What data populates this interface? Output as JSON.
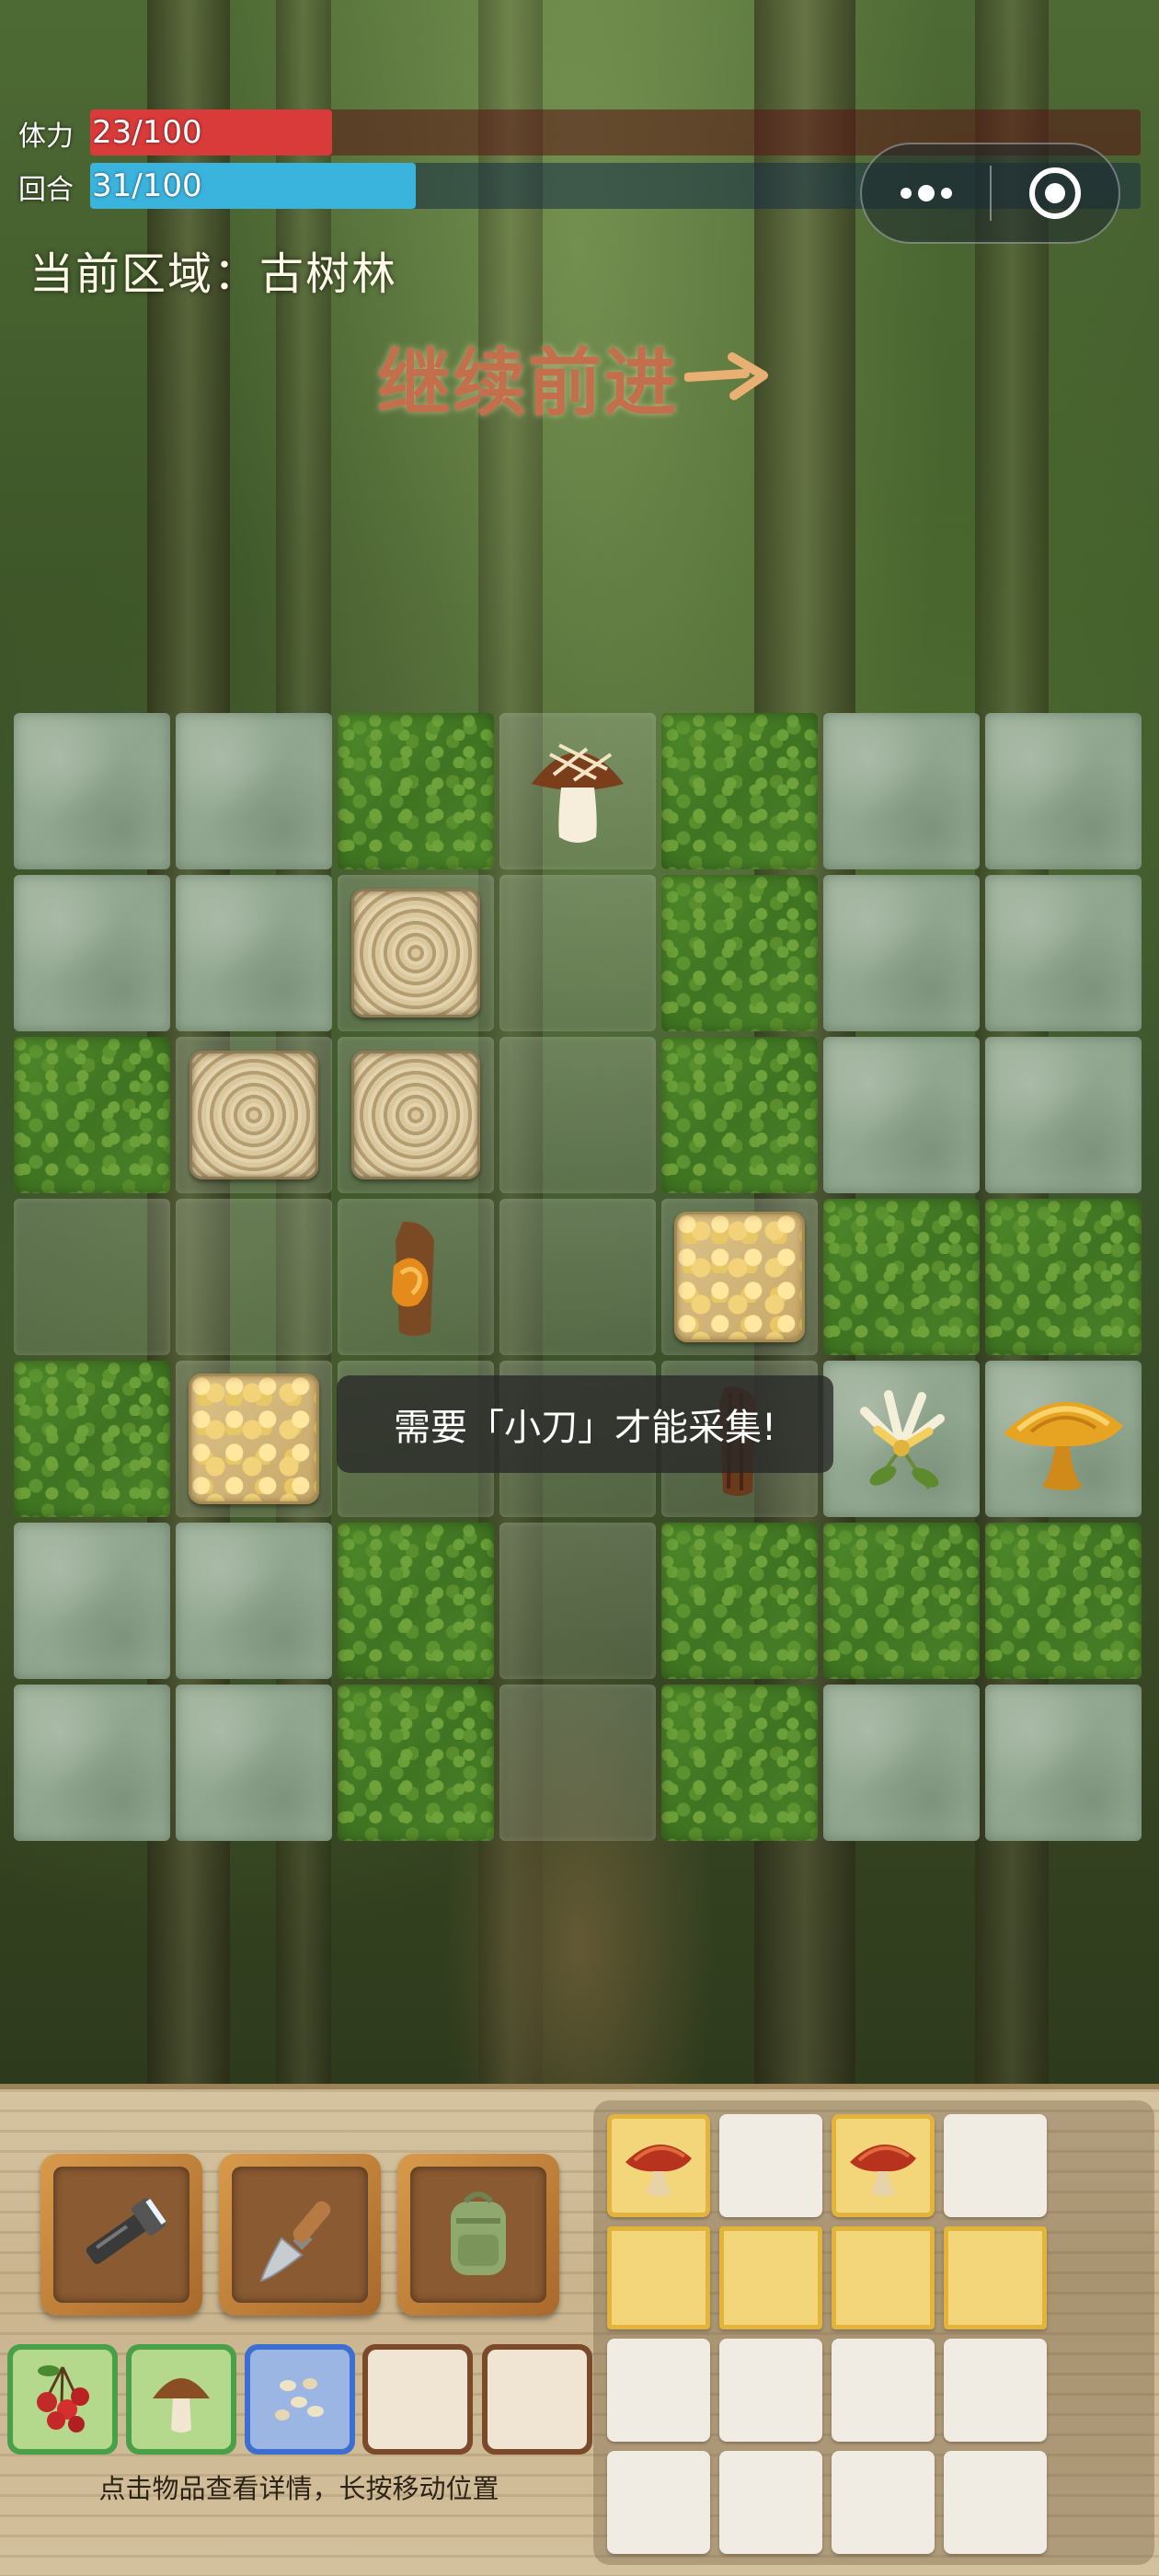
{
  "hud": {
    "stamina": {
      "label": "体力",
      "text": "23/100",
      "fraction": 0.23,
      "color": "#d93a3a"
    },
    "turn": {
      "label": "回合",
      "text": "31/100",
      "fraction": 0.31,
      "color": "#3ab3dd"
    }
  },
  "area": {
    "label": "当前区域：古树林"
  },
  "continue_button": {
    "label": "继续前进"
  },
  "board": {
    "columns": 7,
    "rows": 7,
    "cells": [
      [
        "stone",
        "stone",
        "grass",
        "path:shiitake-mushroom",
        "grass",
        "stone",
        "stone"
      ],
      [
        "stone",
        "stone",
        "path:stump",
        "path",
        "grass",
        "stone",
        "stone"
      ],
      [
        "grass",
        "path:stump",
        "path:stump",
        "path",
        "grass",
        "stone",
        "stone"
      ],
      [
        "path",
        "path",
        "path:resin-bark",
        "path",
        "path:gravel",
        "grass",
        "grass"
      ],
      [
        "grass",
        "path:gravel",
        "path",
        "path",
        "path:bark",
        "stone:honeysuckle-flower",
        "stone:golden-lingzhi"
      ],
      [
        "stone",
        "stone",
        "grass",
        "path",
        "grass",
        "grass",
        "grass"
      ],
      [
        "stone",
        "stone",
        "grass",
        "path",
        "grass",
        "stone",
        "stone"
      ]
    ]
  },
  "toast": {
    "message": "需要「小刀」才能采集!"
  },
  "tools": [
    {
      "name": "flashlight-icon"
    },
    {
      "name": "trowel-icon"
    },
    {
      "name": "backpack-icon"
    }
  ],
  "quick_slots": [
    {
      "style": "green",
      "icon": "berries-icon"
    },
    {
      "style": "green",
      "icon": "mushroom-icon"
    },
    {
      "style": "blue",
      "icon": "seeds-icon"
    },
    {
      "style": "empty",
      "icon": ""
    },
    {
      "style": "empty",
      "icon": ""
    }
  ],
  "hint": "点击物品查看详情，长按移动位置",
  "inventory": {
    "rows": [
      [
        "lingzhi-icon",
        "",
        "lingzhi-icon",
        ""
      ],
      [
        "",
        "",
        "",
        ""
      ],
      [
        "",
        "",
        "",
        ""
      ],
      [
        "",
        "",
        "",
        ""
      ]
    ]
  },
  "colors": {
    "accent_continue": "#c36f4c",
    "tool_frame": "#d89a4a",
    "slot_green": "#49a049",
    "slot_blue": "#3d6fd0",
    "inventory_highlight": "#f4d67a"
  }
}
